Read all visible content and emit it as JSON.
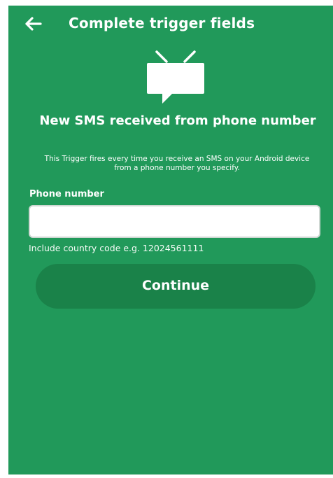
{
  "header": {
    "back_icon": "arrow-left-icon",
    "title": "Complete trigger fields"
  },
  "trigger": {
    "icon": "android-tv-chat-icon",
    "title": "New SMS received from phone number",
    "description": "This Trigger fires every time you receive an SMS on your Android device from a phone number you specify."
  },
  "form": {
    "phone_label": "Phone number",
    "phone_value": "",
    "phone_hint": "Include country code e.g. 12024561111"
  },
  "actions": {
    "continue_label": "Continue"
  },
  "colors": {
    "background": "#21995a",
    "button": "#1a8249",
    "text": "#ffffff"
  }
}
